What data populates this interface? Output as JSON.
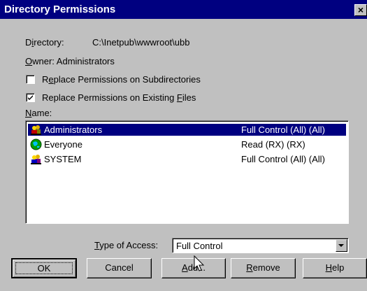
{
  "window": {
    "title": "Directory Permissions",
    "close_glyph": "×"
  },
  "info": {
    "directory_label": "Directory:",
    "directory_value": "C:\\Inetpub\\wwwroot\\ubb",
    "owner_text": "Owner: Administrators"
  },
  "options": [
    {
      "label": "Replace Permissions on Subdirectories",
      "checked": false
    },
    {
      "label": "Replace Permissions on Existing Files",
      "checked": true
    }
  ],
  "list": {
    "label": "Name:",
    "items": [
      {
        "name": "Administrators",
        "permission": "Full Control (All) (All)",
        "selected": true,
        "icon": "group-icon"
      },
      {
        "name": "Everyone",
        "permission": "Read (RX) (RX)",
        "selected": false,
        "icon": "globe-icon"
      },
      {
        "name": "SYSTEM",
        "permission": "Full Control (All) (All)",
        "selected": false,
        "icon": "group-icon"
      }
    ]
  },
  "access": {
    "label": "Type of Access:",
    "value": "Full Control"
  },
  "buttons": {
    "ok": "OK",
    "cancel": "Cancel",
    "add": "Add...",
    "remove": "Remove",
    "help": "Help"
  }
}
